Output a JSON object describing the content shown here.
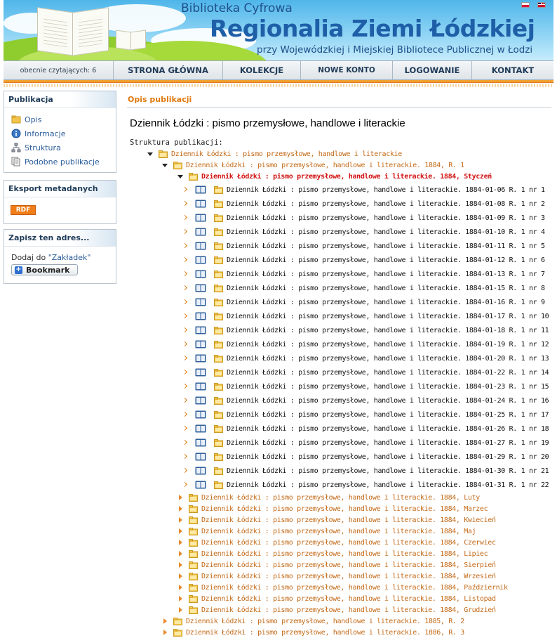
{
  "header": {
    "subtitle": "Biblioteka Cyfrowa",
    "title": "Regionalia Ziemi Łódzkiej",
    "tagline": "przy Wojewódzkiej i Miejskiej Bibliotece Publicznej w Łodzi"
  },
  "menu": {
    "readers": "obecnie czytających: 6",
    "items": [
      "STRONA GŁÓWNA",
      "KOLEKCJE",
      "NOWE KONTO",
      "LOGOWANIE",
      "KONTAKT"
    ]
  },
  "sidebar": {
    "publication": {
      "title": "Publikacja",
      "items": [
        "Opis",
        "Informacje",
        "Struktura",
        "Podobne publikacje"
      ]
    },
    "export": {
      "title": "Eksport metadanych",
      "rdf_label": "RDF"
    },
    "save": {
      "title": "Zapisz ten adres...",
      "text": "Dodaj do ",
      "link": "\"Zakładek\"",
      "bookmark_label": "Bookmark"
    }
  },
  "main": {
    "section_title": "Opis publikacji",
    "publication_title": "Dziennik Łódzki : pismo przemysłowe, handlowe i literackie",
    "structure_label": "Struktura publikacji:"
  },
  "tree": {
    "root": "Dziennik Łódzki : pismo przemysłowe, handlowe i literackie",
    "year_1884": "Dziennik Łódzki : pismo przemysłowe, handlowe i literackie. 1884, R. 1",
    "january": "Dziennik Łódzki : pismo przemysłowe, handlowe i literackie. 1884, Styczeń",
    "issues": [
      "Dziennik Łódzki : pismo przemysłowe, handlowe i literackie. 1884-01-06 R. 1 nr 1",
      "Dziennik Łódzki : pismo przemysłowe, handlowe i literackie. 1884-01-08 R. 1 nr 2",
      "Dziennik Łódzki : pismo przemysłowe, handlowe i literackie. 1884-01-09 R. 1 nr 3",
      "Dziennik Łódzki : pismo przemysłowe, handlowe i literackie. 1884-01-10 R. 1 nr 4",
      "Dziennik Łódzki : pismo przemysłowe, handlowe i literackie. 1884-01-11 R. 1 nr 5",
      "Dziennik Łódzki : pismo przemysłowe, handlowe i literackie. 1884-01-12 R. 1 nr 6",
      "Dziennik Łódzki : pismo przemysłowe, handlowe i literackie. 1884-01-13 R. 1 nr 7",
      "Dziennik Łódzki : pismo przemysłowe, handlowe i literackie. 1884-01-15 R. 1 nr 8",
      "Dziennik Łódzki : pismo przemysłowe, handlowe i literackie. 1884-01-16 R. 1 nr 9",
      "Dziennik Łódzki : pismo przemysłowe, handlowe i literackie. 1884-01-17 R. 1 nr 10",
      "Dziennik Łódzki : pismo przemysłowe, handlowe i literackie. 1884-01-18 R. 1 nr 11",
      "Dziennik Łódzki : pismo przemysłowe, handlowe i literackie. 1884-01-19 R. 1 nr 12",
      "Dziennik Łódzki : pismo przemysłowe, handlowe i literackie. 1884-01-20 R. 1 nr 13",
      "Dziennik Łódzki : pismo przemysłowe, handlowe i literackie. 1884-01-22 R. 1 nr 14",
      "Dziennik Łódzki : pismo przemysłowe, handlowe i literackie. 1884-01-23 R. 1 nr 15",
      "Dziennik Łódzki : pismo przemysłowe, handlowe i literackie. 1884-01-24 R. 1 nr 16",
      "Dziennik Łódzki : pismo przemysłowe, handlowe i literackie. 1884-01-25 R. 1 nr 17",
      "Dziennik Łódzki : pismo przemysłowe, handlowe i literackie. 1884-01-26 R. 1 nr 18",
      "Dziennik Łódzki : pismo przemysłowe, handlowe i literackie. 1884-01-27 R. 1 nr 19",
      "Dziennik Łódzki : pismo przemysłowe, handlowe i literackie. 1884-01-29 R. 1 nr 20",
      "Dziennik Łódzki : pismo przemysłowe, handlowe i literackie. 1884-01-30 R. 1 nr 21",
      "Dziennik Łódzki : pismo przemysłowe, handlowe i literackie. 1884-01-31 R. 1 nr 22"
    ],
    "months": [
      "Dziennik Łódzki : pismo przemysłowe, handlowe i literackie. 1884, Luty",
      "Dziennik Łódzki : pismo przemysłowe, handlowe i literackie. 1884, Marzec",
      "Dziennik Łódzki : pismo przemysłowe, handlowe i literackie. 1884, Kwiecień",
      "Dziennik Łódzki : pismo przemysłowe, handlowe i literackie. 1884, Maj",
      "Dziennik Łódzki : pismo przemysłowe, handlowe i literackie. 1884, Czerwiec",
      "Dziennik Łódzki : pismo przemysłowe, handlowe i literackie. 1884, Lipiec",
      "Dziennik Łódzki : pismo przemysłowe, handlowe i literackie. 1884, Sierpień",
      "Dziennik Łódzki : pismo przemysłowe, handlowe i literackie. 1884, Wrzesień",
      "Dziennik Łódzki : pismo przemysłowe, handlowe i literackie. 1884, Październik",
      "Dziennik Łódzki : pismo przemysłowe, handlowe i literackie. 1884, Listopad",
      "Dziennik Łódzki : pismo przemysłowe, handlowe i literackie. 1884, Grudzień"
    ],
    "years": [
      "Dziennik Łódzki : pismo przemysłowe, handlowe i literackie. 1885, R. 2",
      "Dziennik Łódzki : pismo przemysłowe, handlowe i literackie. 1886, R. 3"
    ]
  },
  "colors": {
    "accent_orange": "#e07a10",
    "link_blue": "#2a5d9a",
    "active_red": "#d21414",
    "title_blue": "#1e5fa8"
  }
}
